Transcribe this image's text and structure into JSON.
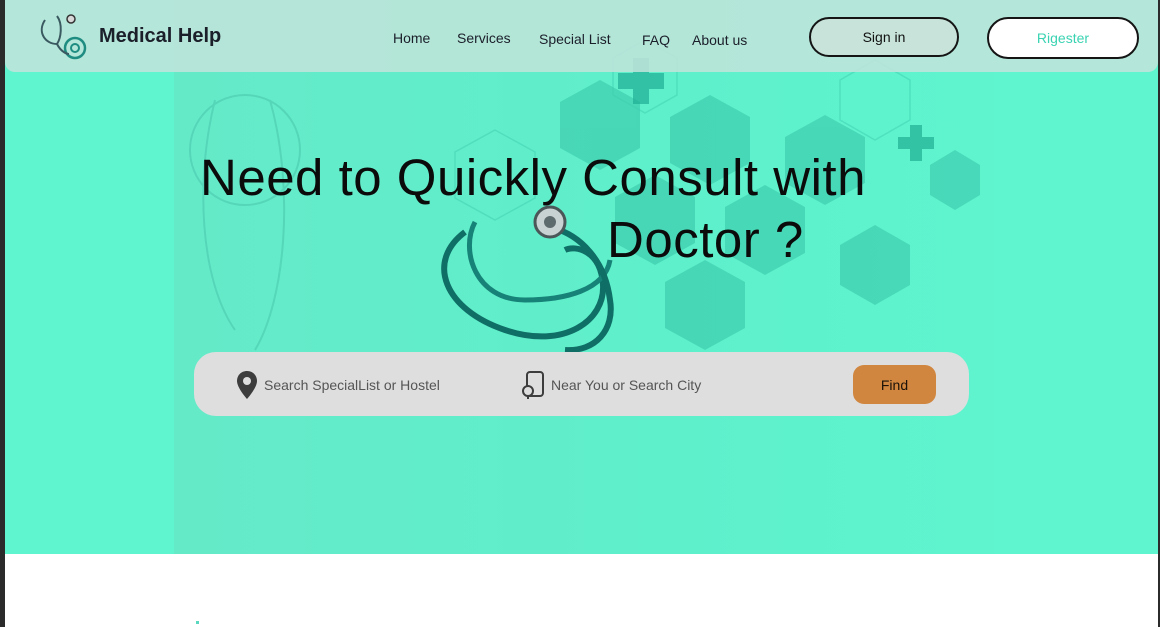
{
  "brand": {
    "name": "Medical Help",
    "logo_icon": "stethoscope-icon"
  },
  "nav": {
    "links": [
      "Home",
      "Services",
      "Special List",
      "FAQ",
      "About us"
    ]
  },
  "auth": {
    "signin_label": "Sign in",
    "register_label": "Rigester"
  },
  "hero": {
    "headline_line1": "Need  to Quickly Consult with",
    "headline_line2": "Doctor ?"
  },
  "search": {
    "specialist_placeholder": "Search SpecialList or Hostel",
    "specialist_icon": "location-pin-icon",
    "city_placeholder": "Near You or Search City",
    "city_icon": "map-icon",
    "find_label": "Find"
  },
  "colors": {
    "hero_bg": "#5ff5cf",
    "navbar_bg": "#c3e4da",
    "accent": "#3ad3b2",
    "find_button": "#d0863f"
  }
}
